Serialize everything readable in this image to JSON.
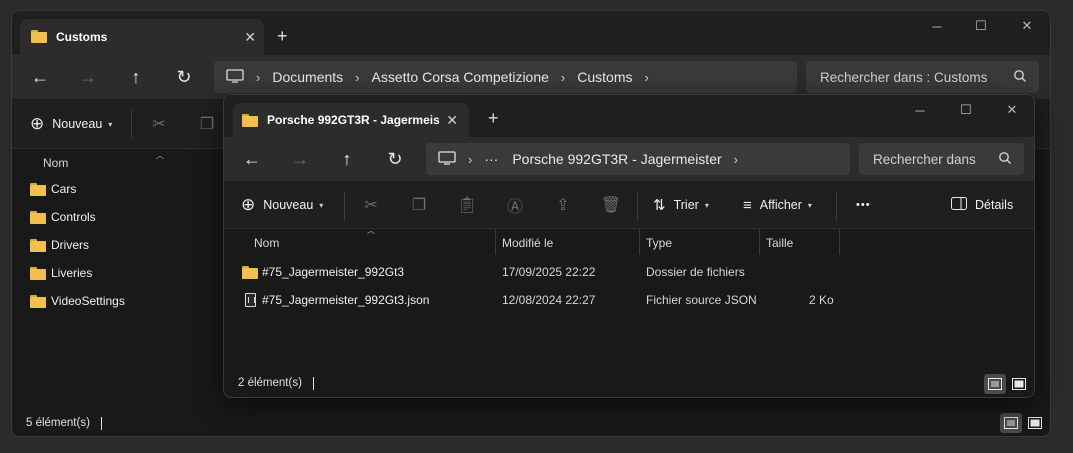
{
  "back_window": {
    "tab_title": "Customs",
    "address": {
      "root_icon": "computer-icon",
      "crumbs": [
        "Documents",
        "Assetto Corsa Competizione",
        "Customs"
      ]
    },
    "search_placeholder": "Rechercher dans : Customs",
    "toolbar": {
      "new_label": "Nouveau"
    },
    "column_name": "Nom",
    "items": [
      {
        "name": "Cars"
      },
      {
        "name": "Controls"
      },
      {
        "name": "Drivers"
      },
      {
        "name": "Liveries"
      },
      {
        "name": "VideoSettings"
      }
    ],
    "status": "5 élément(s)"
  },
  "front_window": {
    "tab_title": "Porsche 992GT3R - Jagermeis",
    "address": {
      "root_icon": "computer-icon",
      "ellipsis": "···",
      "crumbs": [
        "Porsche 992GT3R - Jagermeister"
      ]
    },
    "search_placeholder": "Rechercher dans",
    "toolbar": {
      "new_label": "Nouveau",
      "sort_label": "Trier",
      "view_label": "Afficher",
      "more_label": "•••",
      "details_label": "Détails"
    },
    "columns": {
      "name": "Nom",
      "modified": "Modifié le",
      "type": "Type",
      "size": "Taille"
    },
    "rows": [
      {
        "icon": "folder-icon",
        "name": "#75_Jagermeister_992Gt3",
        "modified": "17/09/2025 22:22",
        "type": "Dossier de fichiers",
        "size": ""
      },
      {
        "icon": "file-icon",
        "name": "#75_Jagermeister_992Gt3.json",
        "modified": "12/08/2024 22:27",
        "type": "Fichier source JSON",
        "size": "2 Ko"
      }
    ],
    "status": "2 élément(s)"
  },
  "colors": {
    "window_bg": "#191919",
    "bar_bg": "#2c2c2c",
    "folder": "#f2c04c"
  }
}
